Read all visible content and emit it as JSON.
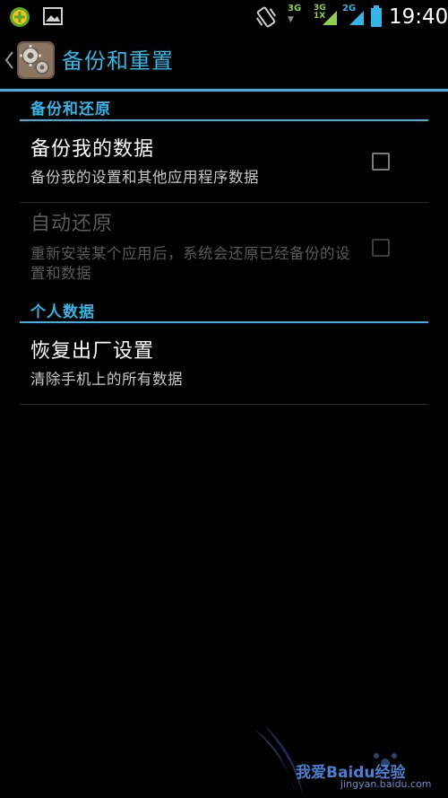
{
  "status_bar": {
    "net_3g": "3G",
    "net_3g_1x_top": "3G",
    "net_3g_1x_bottom": "1X",
    "net_2g": "2G",
    "time": "19:40",
    "icons": [
      "app-notification-icon",
      "gallery-icon",
      "vibrate-icon",
      "signal-icon",
      "battery-icon"
    ]
  },
  "action_bar": {
    "title": "备份和重置",
    "accent": "#33b5e5"
  },
  "sections": {
    "backup": {
      "header": "备份和还原",
      "items": [
        {
          "title": "备份我的数据",
          "summary": "备份我的设置和其他应用程序数据",
          "checked": false,
          "enabled": true
        },
        {
          "title": "自动还原",
          "summary": "重新安装某个应用后，系统会还原已经备份的设置和数据",
          "checked": false,
          "enabled": false
        }
      ]
    },
    "personal": {
      "header": "个人数据",
      "items": [
        {
          "title": "恢复出厂设置",
          "summary": "清除手机上的所有数据"
        }
      ]
    }
  },
  "watermark": {
    "main": "我爱Baidu经验",
    "sub": "jingyan.baidu.com"
  }
}
